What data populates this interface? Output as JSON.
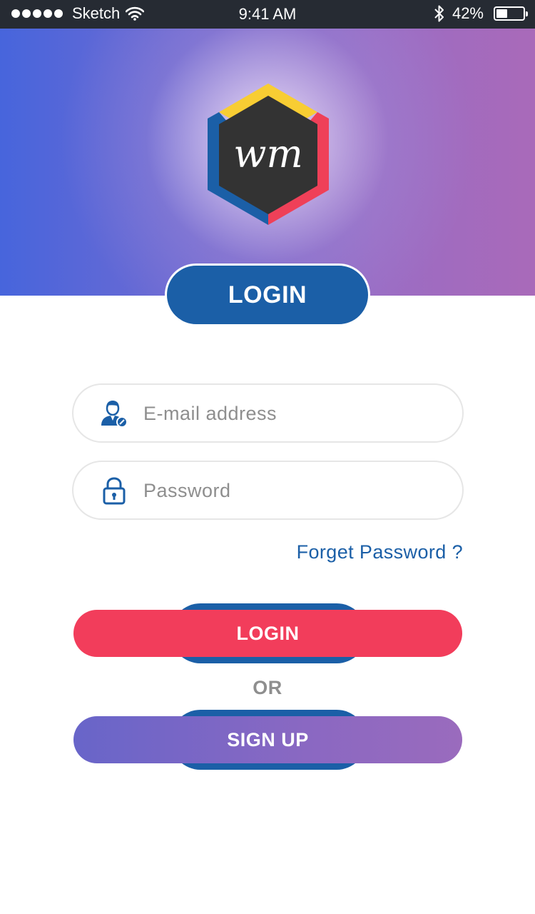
{
  "status_bar": {
    "carrier": "Sketch",
    "time": "9:41 AM",
    "battery_percent": "42%",
    "battery_level": 0.42,
    "icons": [
      "signal-dots-icon",
      "wifi-icon",
      "bluetooth-icon",
      "battery-icon"
    ]
  },
  "header": {
    "logo_text": "wm",
    "tab_label": "LOGIN",
    "colors": {
      "gradient_left": "#4765dc",
      "gradient_right": "#a96ab9",
      "pill": "#1b5fa7"
    }
  },
  "form": {
    "email": {
      "placeholder": "E-mail address",
      "value": "",
      "icon": "user-icon"
    },
    "password": {
      "placeholder": "Password",
      "value": "",
      "icon": "lock-icon"
    },
    "forgot_label": "Forget Password ?"
  },
  "actions": {
    "login_label": "LOGIN",
    "or_label": "OR",
    "signup_label": "SIGN UP",
    "colors": {
      "login": "#f23d5b",
      "signup": "#8a68c2",
      "accent": "#1b5fa7"
    }
  }
}
